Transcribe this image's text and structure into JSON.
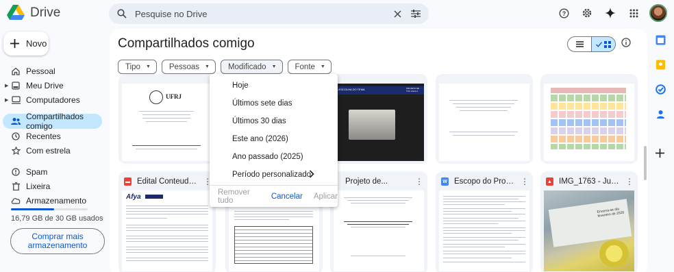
{
  "app": {
    "name": "Drive"
  },
  "search": {
    "placeholder": "Pesquise no Drive"
  },
  "sidebar": {
    "new_label": "Novo",
    "items": [
      {
        "label": "Pessoal",
        "icon": "home-icon"
      },
      {
        "label": "Meu Drive",
        "icon": "my-drive-icon"
      },
      {
        "label": "Computadores",
        "icon": "computer-icon"
      },
      {
        "label": "Compartilhados comigo",
        "icon": "shared-icon"
      },
      {
        "label": "Recentes",
        "icon": "clock-icon"
      },
      {
        "label": "Com estrela",
        "icon": "star-icon"
      },
      {
        "label": "Spam",
        "icon": "spam-icon"
      },
      {
        "label": "Lixeira",
        "icon": "trash-icon"
      },
      {
        "label": "Armazenamento",
        "icon": "cloud-icon"
      }
    ],
    "storage_text": "16,79 GB de 30 GB usados",
    "storage_fraction": 0.56,
    "buy_storage_label": "Comprar mais armazenamento"
  },
  "main": {
    "title": "Compartilhados comigo",
    "filters": [
      "Tipo",
      "Pessoas",
      "Modificado",
      "Fonte"
    ],
    "files_row2": [
      {
        "name": "Edital Conteudistas...",
        "type": "pdf"
      },
      {
        "name": "",
        "type": "pdf"
      },
      {
        "name": "Projeto de...",
        "type": "doc"
      },
      {
        "name": "Escopo do Projeto...",
        "type": "doc"
      },
      {
        "name": "IMG_1763 - Juliann...",
        "type": "image"
      }
    ]
  },
  "menu": {
    "items": [
      "Hoje",
      "Últimos sete dias",
      "Últimos 30 dias",
      "Este ano (2026)",
      "Ano passado (2025)",
      "Período personalizado"
    ],
    "remove_all": "Remover tudo",
    "cancel": "Cancelar",
    "apply": "Aplicar"
  },
  "thumbs": {
    "ufrj_label": "UFRJ",
    "slide_header_left": "A ESCOLHA DO TEMA",
    "slide_header_right": "PROJETO DE TCC AULA 2",
    "afya_label": "Afya",
    "photo_text": "Encerra-se dia fevereiro de 2028"
  },
  "colors": {
    "accent": "#0b57d0",
    "active_nav": "#c2e7ff",
    "pdf": "#ea4335",
    "doc": "#4285f4"
  }
}
